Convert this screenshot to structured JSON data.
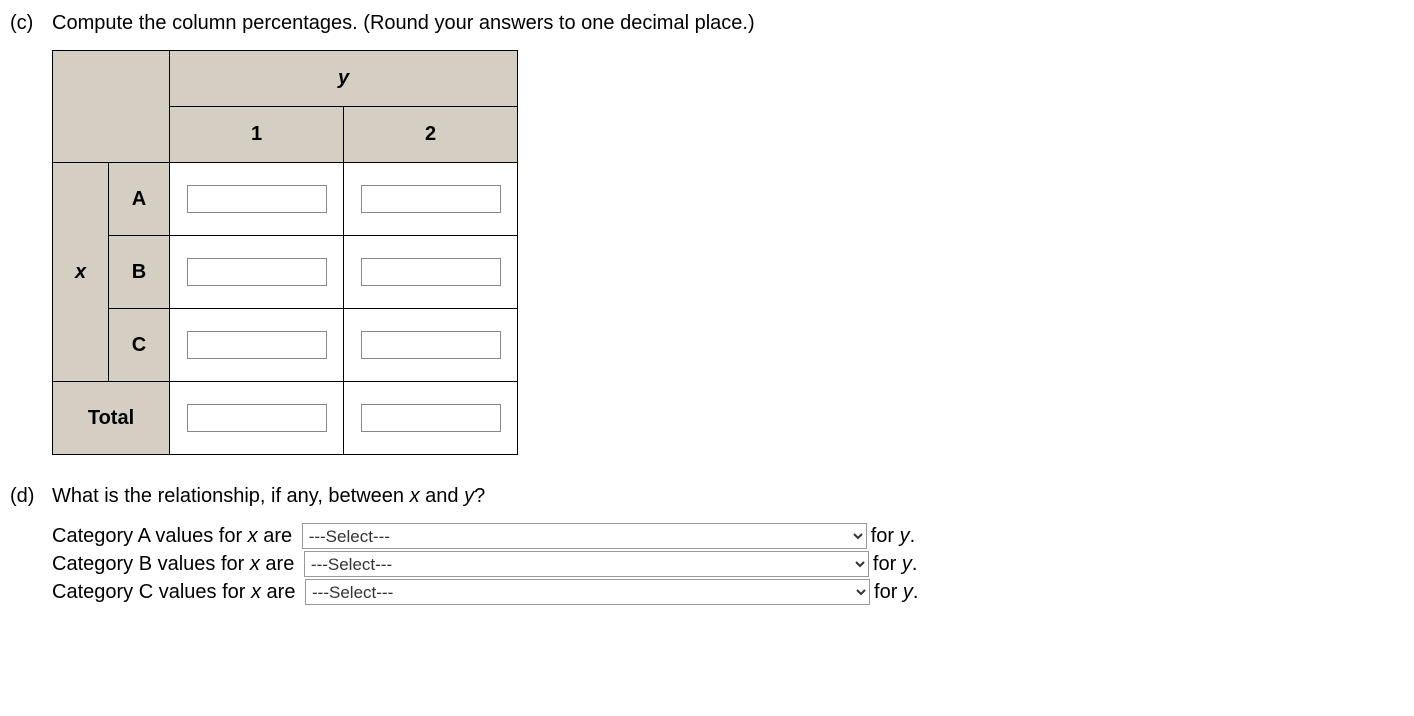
{
  "partC": {
    "label": "(c)",
    "text": "Compute the column percentages. (Round your answers to one decimal place.)",
    "table": {
      "y_label": "y",
      "x_label": "x",
      "col_headers": [
        "1",
        "2"
      ],
      "row_headers": [
        "A",
        "B",
        "C"
      ],
      "total_label": "Total",
      "values": {
        "A1": "",
        "A2": "",
        "B1": "",
        "B2": "",
        "C1": "",
        "C2": "",
        "T1": "",
        "T2": ""
      }
    }
  },
  "partD": {
    "label": "(d)",
    "text_prefix": "What is the relationship, if any, between ",
    "text_var1": "x",
    "text_mid": " and ",
    "text_var2": "y",
    "text_suffix": "?",
    "lines": [
      {
        "prefix": "Category A values for ",
        "var": "x",
        "mid": " are ",
        "suffix_for": "for ",
        "suffix_var": "y",
        "suffix_end": "."
      },
      {
        "prefix": "Category B values for ",
        "var": "x",
        "mid": " are ",
        "suffix_for": "for ",
        "suffix_var": "y",
        "suffix_end": "."
      },
      {
        "prefix": "Category C values for ",
        "var": "x",
        "mid": " are ",
        "suffix_for": "for ",
        "suffix_var": "y",
        "suffix_end": "."
      }
    ],
    "select_placeholder": "---Select---"
  }
}
